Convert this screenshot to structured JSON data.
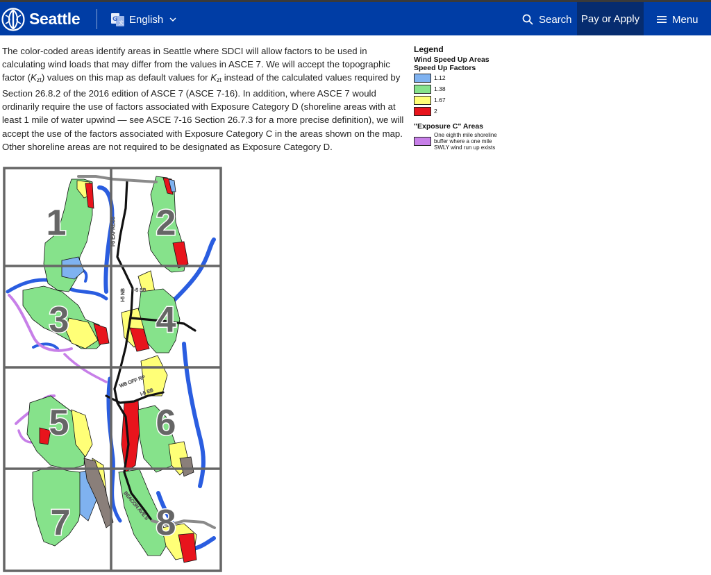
{
  "header": {
    "brand": "Seattle",
    "language": "English",
    "search_label": "Search",
    "pay_label": "Pay or Apply",
    "menu_label": "Menu",
    "bg_color": "#003da5",
    "pay_bg_color": "#062c6f",
    "icons": [
      "seattle-logo-icon",
      "google-translate-icon",
      "chevron-down-icon",
      "search-icon",
      "menu-icon"
    ]
  },
  "description": {
    "part1": "The color-coded areas identify areas in Seattle where SDCI will allow factors to be used in calculating wind loads that may differ from the values in ASCE 7. We will accept the topographic factor (",
    "kzt_symbol_1": "K",
    "kzt_sub_1": "zt",
    "part2": ") values on this map as default values for ",
    "kzt_symbol_2": "K",
    "kzt_sub_2": "zt",
    "part3": " instead of the calculated values required by Section 26.8.2 of the 2016 edition of ASCE 7 (ASCE 7-16). In addition, where ASCE 7 would ordinarily require the use of factors associated with Exposure Category D (shoreline areas with at least 1 mile of water upwind — see ASCE 7-16 Section 26.7.3 for a more precise definition), we will accept the use of the factors associated with Exposure Category C in the areas shown on the map. Other shoreline areas are not required to be designated as Exposure Category D."
  },
  "legend": {
    "title": "Legend",
    "subtitle_line1": "Wind Speed Up Areas",
    "subtitle_line2": "Speed Up Factors",
    "items": [
      {
        "value": "1.12",
        "color": "#7fb2f0"
      },
      {
        "value": "1.38",
        "color": "#86e28b"
      },
      {
        "value": "1.67",
        "color": "#ffff77"
      },
      {
        "value": "2",
        "color": "#e8141c"
      }
    ],
    "exposure_title": "\"Exposure C\" Areas",
    "exposure_text": "One eighth mile shoreline buffer where a one mile SWLY wind run up exists",
    "exposure_color": "#c77fe8"
  },
  "map": {
    "zone_labels": [
      "1",
      "2",
      "3",
      "4",
      "5",
      "6",
      "7",
      "8"
    ],
    "road_labels": [
      "I-5 EXPRESS",
      "I-5 NB",
      "I-5 SB",
      "WB OFF RP",
      "I-5 EB",
      "BEACON AVE S"
    ],
    "colors": {
      "grid": "#666666",
      "shoreline": "#2a5de0",
      "exposure_buffer": "#c77fe8",
      "highway": "#111111",
      "labels": "#666666"
    }
  }
}
